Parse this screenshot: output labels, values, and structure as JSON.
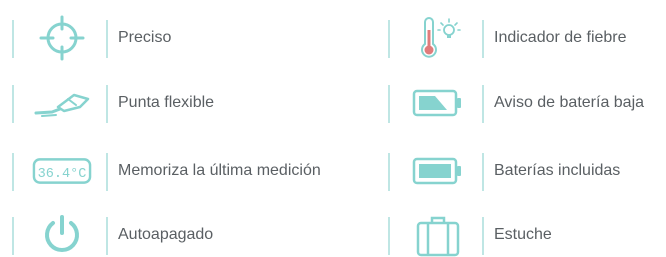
{
  "accent_color": "#86d3cf",
  "features_left": [
    {
      "icon": "crosshair-icon",
      "label": "Preciso"
    },
    {
      "icon": "flexible-tip-icon",
      "label": "Punta flexible"
    },
    {
      "icon": "lcd-display-icon",
      "label": "Memoriza la última medición",
      "display_text": "36.4°C"
    },
    {
      "icon": "power-icon",
      "label": "Autoapagado"
    }
  ],
  "features_right": [
    {
      "icon": "thermometer-light-icon",
      "label": "Indicador de fiebre"
    },
    {
      "icon": "low-battery-icon",
      "label": "Aviso de batería baja"
    },
    {
      "icon": "full-battery-icon",
      "label": "Baterías incluidas"
    },
    {
      "icon": "case-icon",
      "label": "Estuche"
    }
  ]
}
